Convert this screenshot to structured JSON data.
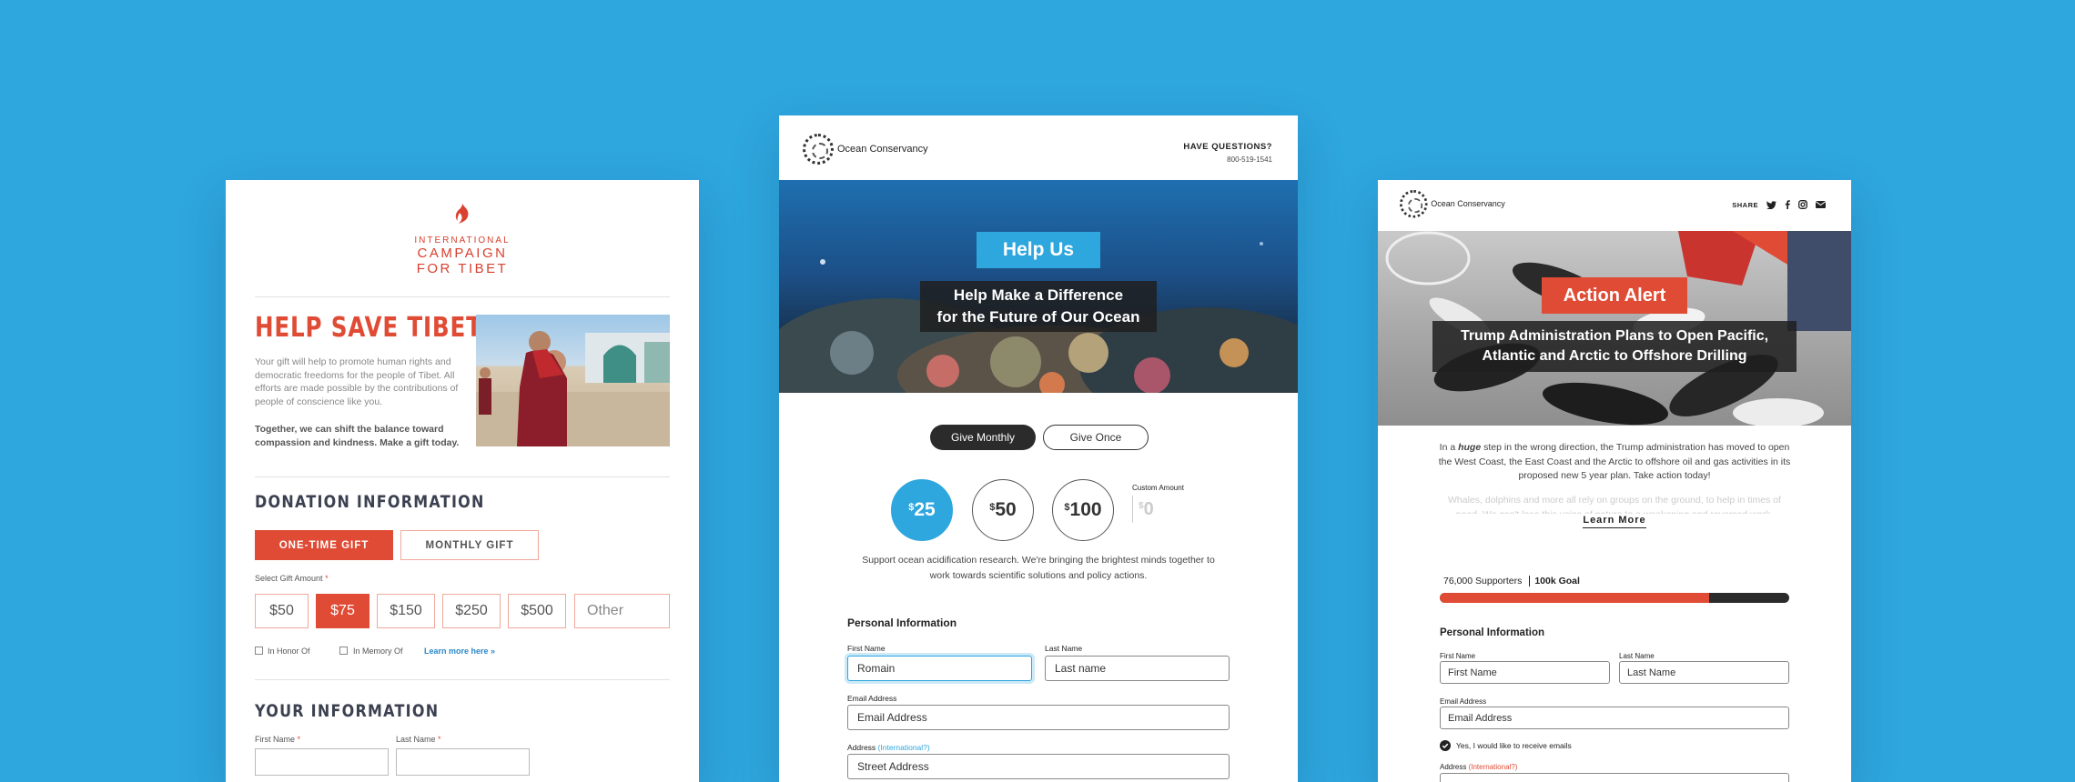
{
  "tibet": {
    "logo_line1": "INTERNATIONAL",
    "logo_line2": "CAMPAIGN",
    "logo_line3": "FOR TIBET",
    "title": "HELP SAVE TIBET",
    "intro": "Your gift will help to promote human rights and democratic freedoms for the people of Tibet. All efforts are made possible by the contributions of people of conscience like you.",
    "intro_bold": "Together, we can shift the balance toward compassion and kindness. Make a gift today.",
    "donation_heading": "DONATION INFORMATION",
    "one_time": "ONE-TIME GIFT",
    "monthly": "MONTHLY GIFT",
    "select_label": "Select Gift Amount",
    "required_mark": "*",
    "amounts": [
      "$50",
      "$75",
      "$150",
      "$250",
      "$500"
    ],
    "other_placeholder": "Other",
    "in_honor": "In Honor Of",
    "in_memory": "In Memory Of",
    "learn_more": "Learn more here »",
    "your_info_heading": "YOUR INFORMATION",
    "first_name_label": "First Name",
    "last_name_label": "Last Name",
    "accent_color": "#e04b35"
  },
  "ocean": {
    "org_name": "Ocean Conservancy",
    "questions": "HAVE QUESTIONS?",
    "phone": "800-519-1541",
    "hero_tag": "Help Us",
    "hero_line1": "Help Make a Difference",
    "hero_line2": "for the Future of Our Ocean",
    "give_monthly": "Give Monthly",
    "give_once": "Give Once",
    "amount_25": "25",
    "amount_50": "50",
    "amount_100": "100",
    "currency": "$",
    "custom_label": "Custom Amount",
    "custom_placeholder": "0",
    "support_text": "Support ocean acidification research. We're bringing the brightest minds together to work towards scientific solutions and policy actions.",
    "personal_heading": "Personal Information",
    "first_name_label": "First Name",
    "first_name_value": "Romain",
    "last_name_label": "Last Name",
    "last_name_placeholder": "Last name",
    "email_label": "Email Address",
    "email_placeholder": "Email Address",
    "address_label": "Address",
    "address_intl": "(International?)",
    "address_placeholder": "Street Address",
    "accent_color": "#2ea6de"
  },
  "alert": {
    "org_name": "Ocean Conservancy",
    "share": "SHARE",
    "hero_tag": "Action Alert",
    "hero_line1": "Trump Administration Plans to Open Pacific,",
    "hero_line2": "Atlantic and Arctic to Offshore Drilling",
    "body_prefix": "In a",
    "body_em": "huge",
    "body_rest": "step in the wrong direction, the Trump administration has moved to open the West Coast, the East Coast and the Arctic to offshore oil and gas activities in its proposed new 5 year plan. Take action today!",
    "body_faded": "Whales, dolphins and more all rely on groups on the ground, to help in times of need. We can't lose this voice of nature to a weakening and reversed work.",
    "learn_more": "Learn More",
    "supporters": "76,000 Supporters",
    "goal": "100k Goal",
    "progress": 0.77,
    "personal_heading": "Personal Information",
    "first_name_label": "First Name",
    "first_name_placeholder": "First Name",
    "last_name_label": "Last Name",
    "last_name_placeholder": "Last Name",
    "email_label": "Email Address",
    "email_placeholder": "Email Address",
    "opt_in": "Yes, I would like to receive emails",
    "address_label": "Address",
    "address_intl": "(International?)",
    "accent_color": "#e04b35"
  }
}
